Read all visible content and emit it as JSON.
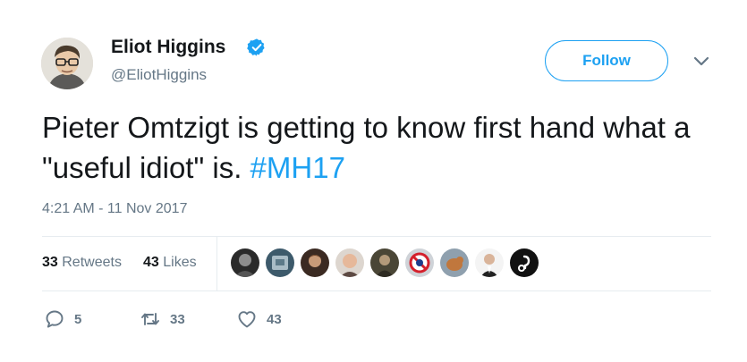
{
  "author": {
    "name": "Eliot Higgins",
    "handle": "@EliotHiggins"
  },
  "follow_label": "Follow",
  "tweet": {
    "text": "Pieter Omtzigt is getting to know first hand what a \"useful idiot\" is.",
    "hashtag": "#MH17"
  },
  "timestamp": "4:21 AM - 11 Nov 2017",
  "stats": {
    "retweets_count": "33",
    "retweets_label": "Retweets",
    "likes_count": "43",
    "likes_label": "Likes"
  },
  "actions": {
    "replies": "5",
    "retweets": "33",
    "likes": "43"
  },
  "colors": {
    "accent": "#1da1f2",
    "text": "#14171a",
    "muted": "#657786",
    "divider": "#e6ecf0"
  }
}
